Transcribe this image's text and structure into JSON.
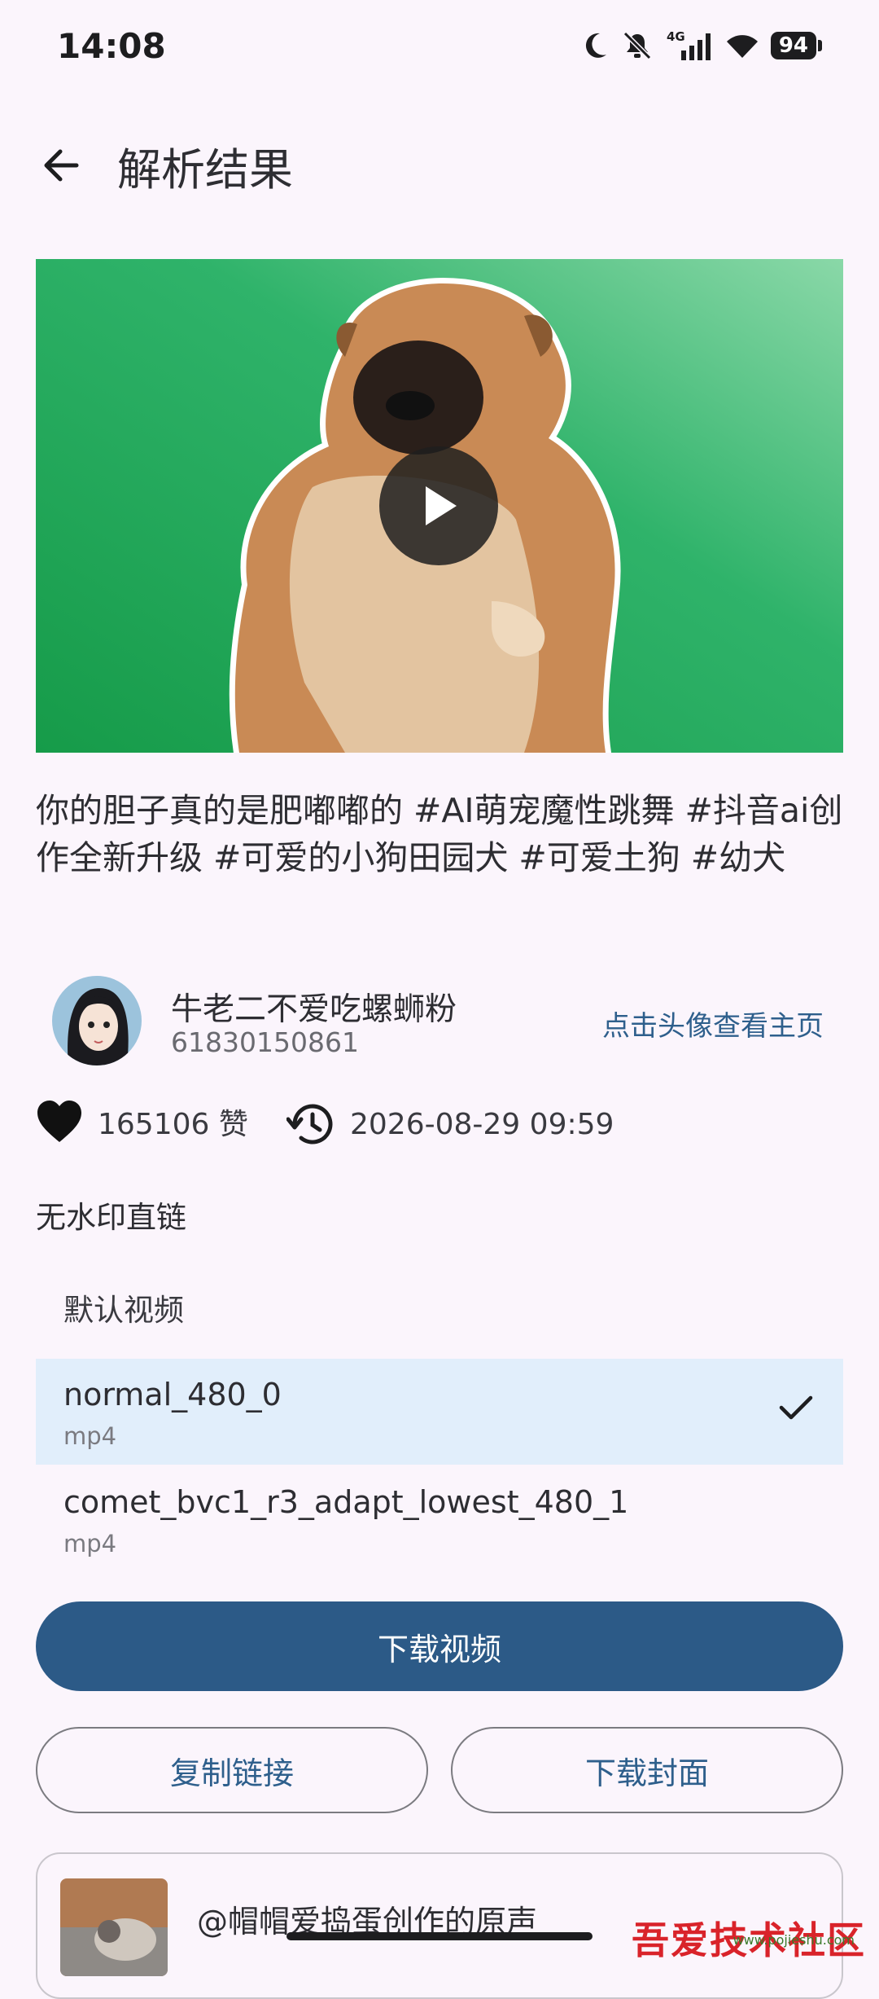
{
  "status_bar": {
    "time": "14:08",
    "network": "4G",
    "battery": "94",
    "icons": [
      "moon-icon",
      "mute-bell-icon",
      "signal-icon",
      "wifi-icon",
      "battery-icon"
    ]
  },
  "header": {
    "title": "解析结果",
    "back_icon": "arrow-left-icon"
  },
  "video": {
    "play_icon": "play-icon"
  },
  "description": "你的胆子真的是肥嘟嘟的 #AI萌宠魔性跳舞 #抖音ai创作全新升级 #可爱的小狗田园犬 #可爱土狗 #幼犬",
  "author": {
    "name": "牛老二不爱吃螺蛳粉",
    "id": "61830150861",
    "profile_link": "点击头像查看主页"
  },
  "stats": {
    "likes": "165106 赞",
    "publish_time": "2026-08-29 09:59"
  },
  "links": {
    "section_title": "无水印直链",
    "quality_label": "默认视频",
    "formats": [
      {
        "name": "normal_480_0",
        "ext": "mp4",
        "selected": true
      },
      {
        "name": "comet_bvc1_r3_adapt_lowest_480_1",
        "ext": "mp4",
        "selected": false
      }
    ]
  },
  "actions": {
    "download_video": "下载视频",
    "copy_link": "复制链接",
    "download_cover": "下载封面"
  },
  "music": {
    "title": "@帽帽爱捣蛋创作的原声"
  },
  "watermark": {
    "text": "吾爱技术社区",
    "url": "www.pojieshu.com"
  },
  "colors": {
    "background": "#fbf5fc",
    "primary": "#2c5a87",
    "link": "#2e5f8c",
    "selected_row": "#e1eefb",
    "video_bg": "#2fae64"
  }
}
